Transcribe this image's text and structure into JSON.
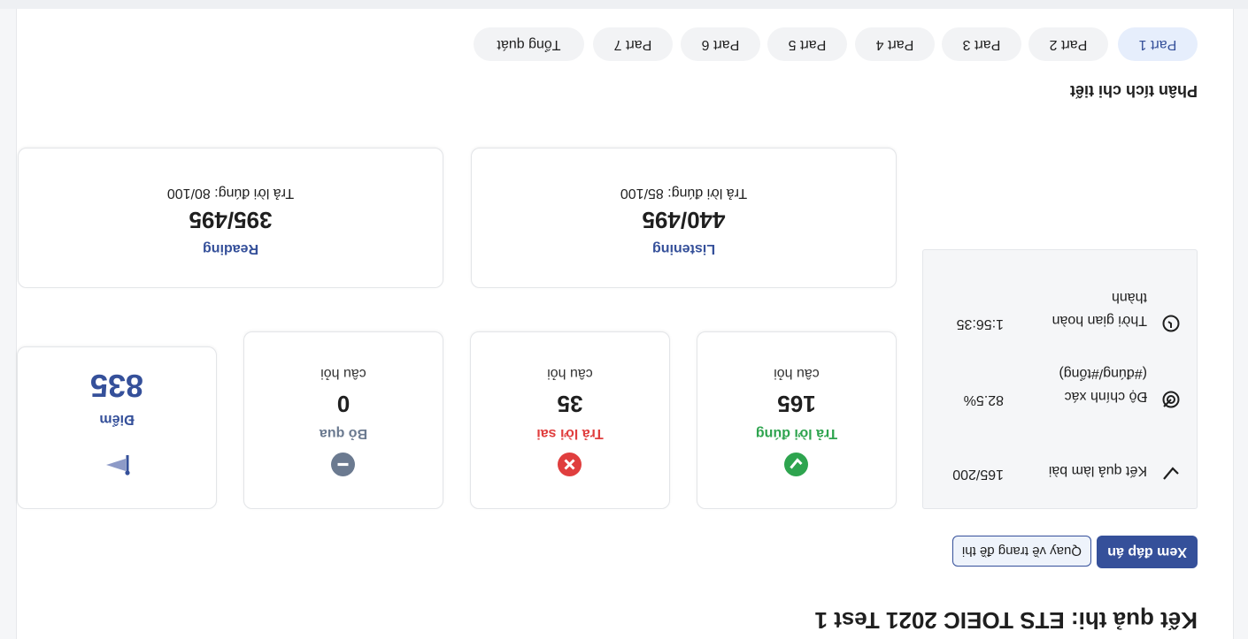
{
  "page": {
    "title": "Kết quả thi: ETS TOEIC 2021 Test 1"
  },
  "actions": {
    "view_answers": "Xem đáp án",
    "back_to_test": "Quay về trang đề thi"
  },
  "summary": {
    "rows": [
      {
        "icon": "check-icon",
        "label": "Kết quả làm bài",
        "value": "165/200"
      },
      {
        "icon": "target-icon",
        "label": "Độ chính xác (#đúng/#tổng)",
        "value": "82.5%"
      },
      {
        "icon": "clock-icon",
        "label": "Thời gian hoàn thành",
        "value": "1:56:35"
      }
    ]
  },
  "stats": {
    "correct": {
      "label": "Trả lời đúng",
      "value": "165",
      "unit": "câu hỏi",
      "color": "#2ea44f"
    },
    "wrong": {
      "label": "Trả lời sai",
      "value": "35",
      "unit": "câu hỏi",
      "color": "#e03e3e"
    },
    "skipped": {
      "label": "Bỏ qua",
      "value": "0",
      "unit": "câu hỏi",
      "color": "#6b7a90"
    },
    "score": {
      "label": "Điểm",
      "value": "835",
      "color": "#35509a"
    }
  },
  "skills": {
    "listening": {
      "name": "Listening",
      "score": "440/495",
      "correct": "Trả lời đúng: 85/100"
    },
    "reading": {
      "name": "Reading",
      "score": "395/495",
      "correct": "Trả lời đúng: 80/100"
    }
  },
  "analysis": {
    "title": "Phân tích chi tiết",
    "tabs": [
      {
        "label": "Part 1",
        "active": true
      },
      {
        "label": "Part 2",
        "active": false
      },
      {
        "label": "Part 3",
        "active": false
      },
      {
        "label": "Part 4",
        "active": false
      },
      {
        "label": "Part 5",
        "active": false
      },
      {
        "label": "Part 6",
        "active": false
      },
      {
        "label": "Part 7",
        "active": false
      },
      {
        "label": "Tổng quát",
        "active": false
      }
    ]
  }
}
